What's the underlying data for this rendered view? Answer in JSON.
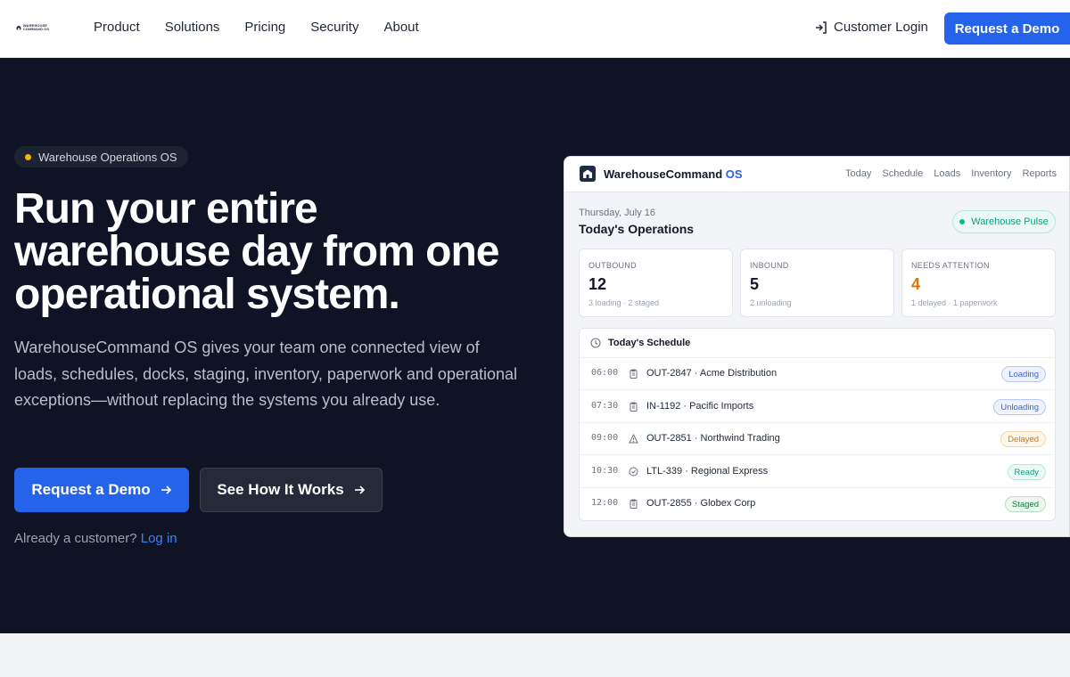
{
  "nav": {
    "logo_text": "WAREHOUSE COMMAND OS",
    "links": [
      "Product",
      "Solutions",
      "Pricing",
      "Security",
      "About"
    ],
    "login_label": "Customer Login",
    "cta_label": "Request a Demo"
  },
  "hero": {
    "pill": "Warehouse Operations OS",
    "headline": "Run your entire warehouse day from one operational system.",
    "subtext": "WarehouseCommand OS gives your team one connected view of loads, schedules, docks, staging, inventory, paperwork and operational exceptions—without replacing the systems you already use.",
    "primary_button": "Request a Demo",
    "secondary_button": "See How It Works",
    "already_text": "Already a customer?",
    "login_link": "Log in"
  },
  "dashboard": {
    "brand": "WarehouseCommand",
    "brand_suffix": "OS",
    "tabs": [
      "Today",
      "Schedule",
      "Loads",
      "Inventory",
      "Reports"
    ],
    "date": "Thursday, July 16",
    "title": "Today's Operations",
    "pulse": "Warehouse Pulse",
    "stats": [
      {
        "label": "OUTBOUND",
        "value": "12",
        "sub": "3 loading · 2 staged"
      },
      {
        "label": "INBOUND",
        "value": "5",
        "sub": "2 unloading"
      },
      {
        "label": "NEEDS ATTENTION",
        "value": "4",
        "sub": "1 delayed · 1 paperwork"
      }
    ],
    "schedule_title": "Today's Schedule",
    "schedule": [
      {
        "time": "06:00",
        "name": "OUT-2847 · Acme Distribution",
        "status": "Loading",
        "icon": "clipboard-icon"
      },
      {
        "time": "07:30",
        "name": "IN-1192 · Pacific Imports",
        "status": "Unloading",
        "icon": "clipboard-icon"
      },
      {
        "time": "09:00",
        "name": "OUT-2851 · Northwind Trading",
        "status": "Delayed",
        "icon": "warning-icon"
      },
      {
        "time": "10:30",
        "name": "LTL-339 · Regional Express",
        "status": "Ready",
        "icon": "check-circle-icon"
      },
      {
        "time": "12:00",
        "name": "OUT-2855 · Globex Corp",
        "status": "Staged",
        "icon": "clipboard-icon"
      }
    ]
  },
  "colors": {
    "accent": "#2563eb",
    "hero_bg": "#0f1324",
    "pill_dot": "#f5b400",
    "attention": "#d97706"
  }
}
